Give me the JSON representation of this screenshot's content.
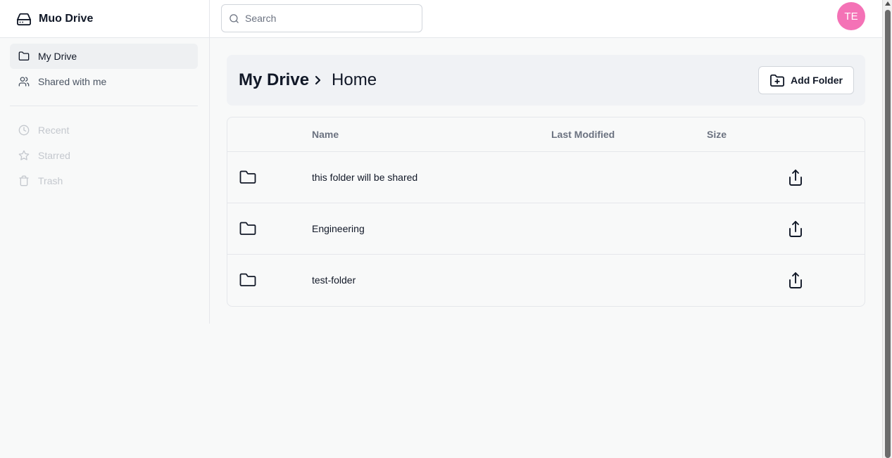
{
  "app": {
    "title": "Muo Drive"
  },
  "sidebar": {
    "items": [
      {
        "label": "My Drive",
        "icon": "folder-icon",
        "active": true
      },
      {
        "label": "Shared with me",
        "icon": "users-icon"
      }
    ],
    "secondary": [
      {
        "label": "Recent",
        "icon": "clock-icon"
      },
      {
        "label": "Starred",
        "icon": "star-icon"
      },
      {
        "label": "Trash",
        "icon": "trash-icon"
      }
    ]
  },
  "search": {
    "placeholder": "Search",
    "value": ""
  },
  "user": {
    "initials": "TE",
    "avatar_color": "#f472b6"
  },
  "breadcrumb": {
    "root": "My Drive",
    "current": "Home"
  },
  "actions": {
    "add_folder": "Add Folder"
  },
  "table": {
    "columns": [
      "Name",
      "Last Modified",
      "Size"
    ],
    "rows": [
      {
        "name": "this folder will be shared",
        "last_modified": "",
        "size": ""
      },
      {
        "name": "Engineering",
        "last_modified": "",
        "size": ""
      },
      {
        "name": "test-folder",
        "last_modified": "",
        "size": ""
      }
    ]
  }
}
